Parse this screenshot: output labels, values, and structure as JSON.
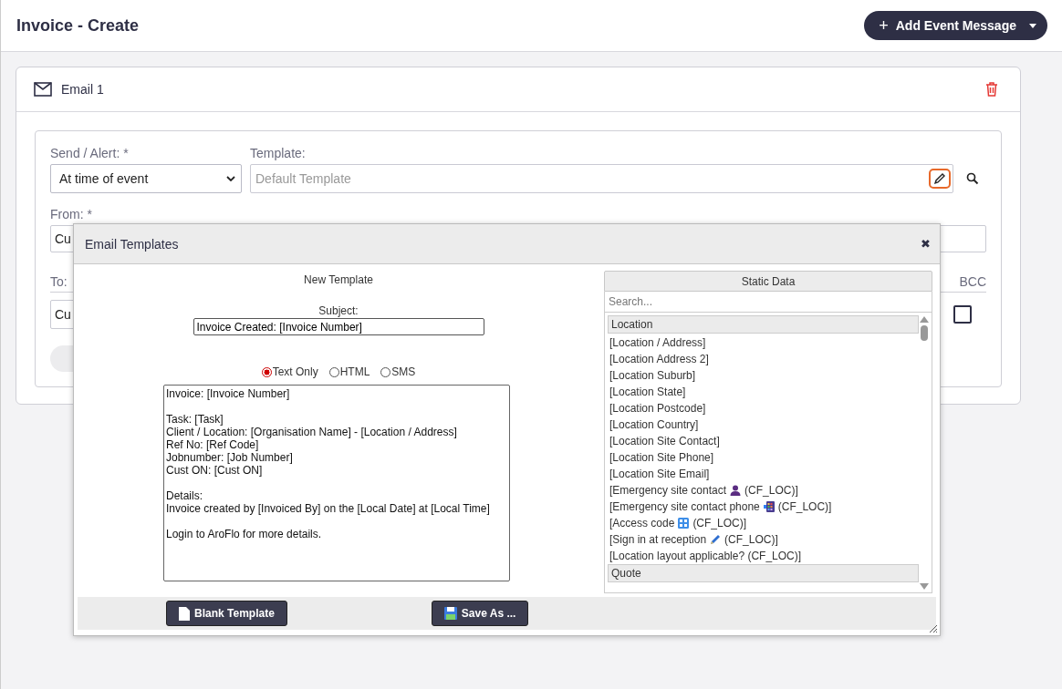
{
  "page": {
    "title": "Invoice - Create",
    "add_button": {
      "icon": "+",
      "label": "Add Event Message"
    }
  },
  "card": {
    "title": "Email 1",
    "send_alert": {
      "label": "Send / Alert: *",
      "value": "At time of event"
    },
    "template": {
      "label": "Template:",
      "placeholder": "Default Template"
    },
    "from": {
      "label": "From: *",
      "value": "Cu"
    },
    "to": {
      "label": "To:",
      "value": "Cu"
    },
    "bcc": {
      "label": "BCC",
      "checked": false
    }
  },
  "dialog": {
    "title": "Email Templates",
    "close": "✖",
    "heading": "New Template",
    "subject": {
      "label": "Subject:",
      "value": "Invoice Created: [Invoice Number]"
    },
    "formats": [
      {
        "label": "Text Only",
        "selected": true
      },
      {
        "label": "HTML",
        "selected": false
      },
      {
        "label": "SMS",
        "selected": false
      }
    ],
    "body": [
      [
        "Invoice: [Invoice Number]"
      ],
      [
        "Task: [Task]",
        "Client / Location: [Organisation Name] - [Location / Address]",
        "Ref No: [Ref Code]",
        "Jobnumber: [Job Number]",
        "Cust ON: [Cust ON]"
      ],
      [
        "Details:",
        "Invoice created by [Invoiced By] on the [Local Date] at [Local Time]"
      ],
      [
        "Login to AroFlo for more details."
      ]
    ],
    "static_data": {
      "title": "Static Data",
      "search_placeholder": "Search...",
      "items": [
        {
          "kind": "group",
          "text": "Location"
        },
        {
          "kind": "field",
          "text": "[Location / Address]"
        },
        {
          "kind": "field",
          "text": "[Location Address 2]"
        },
        {
          "kind": "field",
          "text": "[Location Suburb]"
        },
        {
          "kind": "field",
          "text": "[Location State]"
        },
        {
          "kind": "field",
          "text": "[Location Postcode]"
        },
        {
          "kind": "field",
          "text": "[Location Country]"
        },
        {
          "kind": "field",
          "text": "[Location Site Contact]"
        },
        {
          "kind": "field",
          "text": "[Location Site Phone]"
        },
        {
          "kind": "field",
          "text": "[Location Site Email]"
        },
        {
          "kind": "field",
          "text": "[Emergency site contact",
          "suffix": "(CF_LOC)]"
        },
        {
          "kind": "field",
          "text": "[Emergency site contact phone",
          "suffix": "(CF_LOC)]"
        },
        {
          "kind": "field",
          "text": "[Access code",
          "suffix": "(CF_LOC)]"
        },
        {
          "kind": "field",
          "text": "[Sign in at reception",
          "suffix": "(CF_LOC)]"
        },
        {
          "kind": "field",
          "text": "[Location layout applicable? (CF_LOC)]"
        },
        {
          "kind": "group",
          "text": "Quote"
        }
      ]
    },
    "buttons": [
      {
        "kind": "blank",
        "label": "Blank Template"
      },
      {
        "kind": "save",
        "label": "Save As ..."
      }
    ]
  }
}
